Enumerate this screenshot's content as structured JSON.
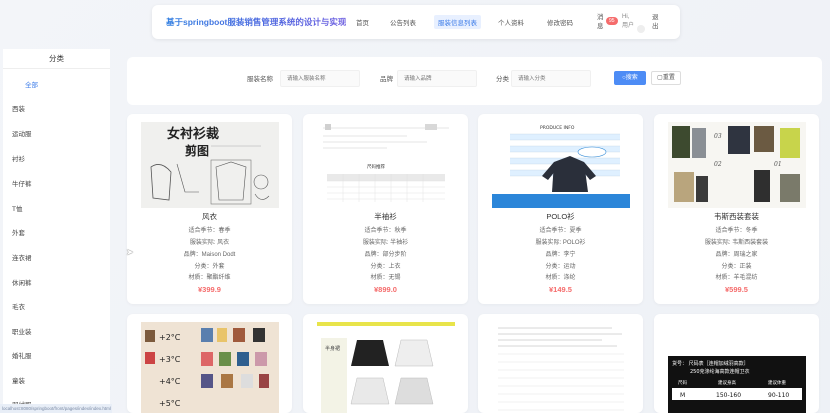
{
  "header": {
    "site_title": "基于springboot服装销售管理系统的设计与实现",
    "nav": [
      "首页",
      "公告列表",
      "服装信息列表",
      "个人资料",
      "修改密码"
    ],
    "messages": "消息",
    "message_count": "95",
    "greeting": "Hi, 用户",
    "logout": "退出"
  },
  "sidebar": {
    "title": "分类",
    "items": [
      "全部",
      "西装",
      "运动服",
      "衬衫",
      "牛仔裤",
      "T恤",
      "外套",
      "连衣裙",
      "休闲裤",
      "毛衣",
      "职业装",
      "婚礼服",
      "童装",
      "羽绒服"
    ]
  },
  "search": {
    "name_label": "服装名称",
    "name_placeholder": "请输入服装名称",
    "brand_label": "品牌",
    "brand_placeholder": "请输入品牌",
    "category_label": "分类",
    "category_placeholder": "请输入分类",
    "search_button": "搜索",
    "reset_button": "重置"
  },
  "cards": [
    {
      "name": "风衣",
      "season": "适合季节：春季",
      "material": "服装实际: 风衣",
      "brand": "品牌：Maison Dodt",
      "category": "分类：外套",
      "fabric": "材质：聚酯纤维",
      "price": "¥399.9"
    },
    {
      "name": "半袖衫",
      "season": "适合季节：秋季",
      "material": "服装实际: 半袖衫",
      "brand": "品牌：部分步阶",
      "category": "分类：上衣",
      "fabric": "材质：无锡",
      "price": "¥899.0"
    },
    {
      "name": "POLO衫",
      "season": "适合季节：夏季",
      "material": "服装实际: POLO衫",
      "brand": "品牌：李宁",
      "category": "分类：运动",
      "fabric": "材质：涤纶",
      "price": "¥149.5"
    },
    {
      "name": "韦斯西装套装",
      "season": "适合季节：冬季",
      "material": "服装实际: 韦斯西装套装",
      "brand": "品牌：周瑞之家",
      "category": "分类：正装",
      "fabric": "材质：羊毛混纺",
      "price": "¥599.5"
    }
  ],
  "thumb_texts": {
    "c1_title": "女衬衫裁",
    "c1_sub": "剪图",
    "c2_title": "尺码推荐",
    "c3_title": "PRODUCE INFO",
    "c4_labels": [
      "03",
      "02",
      "01"
    ],
    "r2_temps": [
      "+2°C",
      "+3°C",
      "+4°C",
      "+5°C"
    ],
    "r2c2_title": "半身裙",
    "r2c4_line1": "货号：  尺码表［连帽加绒羽高款］",
    "r2c4_line2": "250克涤纶海高款连帽卫衣",
    "r2c4_h1": "尺码",
    "r2c4_h2": "建议身高",
    "r2c4_h3": "建议体重",
    "r2c4_v1": "M",
    "r2c4_v2": "150-160",
    "r2c4_v3": "90-110"
  },
  "status_url": "localhost:8080/springboot/front/pages/index/index.html"
}
